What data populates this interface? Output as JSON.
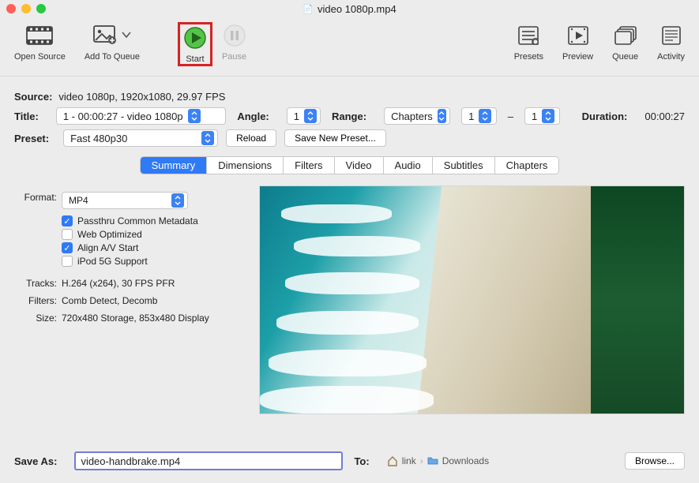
{
  "window": {
    "title": "video 1080p.mp4"
  },
  "toolbar": {
    "open_source": "Open Source",
    "add_to_queue": "Add To Queue",
    "start": "Start",
    "pause": "Pause",
    "presets": "Presets",
    "preview": "Preview",
    "queue": "Queue",
    "activity": "Activity"
  },
  "source": {
    "label": "Source:",
    "value": "video 1080p, 1920x1080, 29.97 FPS"
  },
  "title": {
    "label": "Title:",
    "value": "1 - 00:00:27 - video 1080p"
  },
  "angle": {
    "label": "Angle:",
    "value": "1"
  },
  "range": {
    "label": "Range:",
    "type": "Chapters",
    "from": "1",
    "sep": "–",
    "to": "1"
  },
  "duration": {
    "label": "Duration:",
    "value": "00:00:27"
  },
  "preset": {
    "label": "Preset:",
    "value": "Fast 480p30",
    "reload_btn": "Reload",
    "save_btn": "Save New Preset..."
  },
  "tabs": [
    "Summary",
    "Dimensions",
    "Filters",
    "Video",
    "Audio",
    "Subtitles",
    "Chapters"
  ],
  "active_tab": 0,
  "summary": {
    "format_label": "Format:",
    "format_value": "MP4",
    "checks": {
      "passthru": {
        "label": "Passthru Common Metadata",
        "checked": true
      },
      "weboptimized": {
        "label": "Web Optimized",
        "checked": false
      },
      "alignav": {
        "label": "Align A/V Start",
        "checked": true
      },
      "ipod5g": {
        "label": "iPod 5G Support",
        "checked": false
      }
    },
    "tracks_label": "Tracks:",
    "tracks_value": "H.264 (x264), 30 FPS PFR",
    "filters_label": "Filters:",
    "filters_value": "Comb Detect, Decomb",
    "size_label": "Size:",
    "size_value": "720x480 Storage, 853x480 Display"
  },
  "bottom": {
    "saveas_label": "Save As:",
    "saveas_value": "video-handbrake.mp4",
    "to_label": "To:",
    "path1": "link",
    "path2": "Downloads",
    "browse_btn": "Browse..."
  }
}
